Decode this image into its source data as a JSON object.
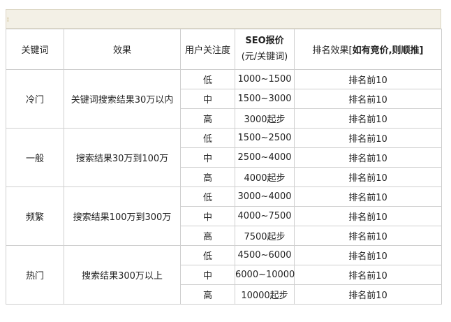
{
  "topbar": {
    "marker": "¦"
  },
  "table": {
    "headers": {
      "keyword": "关键词",
      "effect": "效果",
      "attention": "用户关注度",
      "price_title": "SEO报价",
      "price_sub": "(元/关键词)",
      "rank_prefix": "排名效果[",
      "rank_bold": "如有竞价,则顺推",
      "rank_suffix": "]"
    },
    "groups": [
      {
        "category": "冷门",
        "effect": "关键词搜索结果30万以内",
        "rows": [
          {
            "level": "低",
            "price": "1000~1500",
            "rank": "排名前10"
          },
          {
            "level": "中",
            "price": "1500~3000",
            "rank": "排名前10"
          },
          {
            "level": "高",
            "price": "3000起步",
            "rank": "排名前10"
          }
        ]
      },
      {
        "category": "一般",
        "effect": "搜索结果30万到100万",
        "rows": [
          {
            "level": "低",
            "price": "1500~2500",
            "rank": "排名前10"
          },
          {
            "level": "中",
            "price": "2500~4000",
            "rank": "排名前10"
          },
          {
            "level": "高",
            "price": "4000起步",
            "rank": "排名前10"
          }
        ]
      },
      {
        "category": "频繁",
        "effect": "搜索结果100万到300万",
        "rows": [
          {
            "level": "低",
            "price": "3000~4000",
            "rank": "排名前10"
          },
          {
            "level": "中",
            "price": "4000~7500",
            "rank": "排名前10"
          },
          {
            "level": "高",
            "price": "7500起步",
            "rank": "排名前10"
          }
        ]
      },
      {
        "category": "热门",
        "effect": "搜索结果300万以上",
        "rows": [
          {
            "level": "低",
            "price": "4500~6000",
            "rank": "排名前10"
          },
          {
            "level": "中",
            "price": "6000~10000",
            "rank": "排名前10"
          },
          {
            "level": "高",
            "price": "10000起步",
            "rank": "排名前10"
          }
        ]
      }
    ]
  }
}
